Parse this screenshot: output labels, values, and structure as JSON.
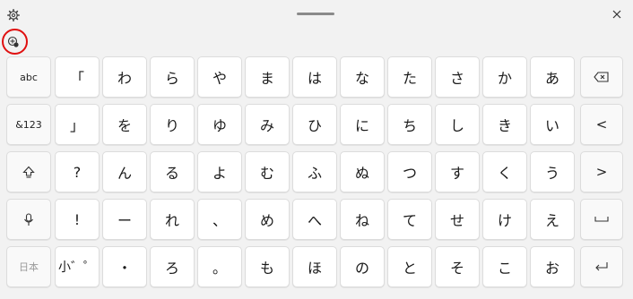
{
  "window": {
    "settings_icon": "gear-icon",
    "close_icon": "close-icon",
    "ime_icon": "ime-mode-icon"
  },
  "keys": {
    "row1": [
      "「",
      "わ",
      "ら",
      "や",
      "ま",
      "は",
      "な",
      "た",
      "さ",
      "か",
      "あ"
    ],
    "row2": [
      "」",
      "を",
      "り",
      "ゆ",
      "み",
      "ひ",
      "に",
      "ち",
      "し",
      "き",
      "い"
    ],
    "row3": [
      "?",
      "ん",
      "る",
      "よ",
      "む",
      "ふ",
      "ぬ",
      "つ",
      "す",
      "く",
      "う"
    ],
    "row4": [
      "!",
      "ー",
      "れ",
      "、",
      "め",
      "へ",
      "ね",
      "て",
      "せ",
      "け",
      "え"
    ],
    "row5": [
      "小゛゜",
      "・",
      "ろ",
      "。",
      "も",
      "ほ",
      "の",
      "と",
      "そ",
      "こ",
      "お"
    ]
  },
  "left_keys": {
    "abc": "abc",
    "symbols": "&123",
    "shift_icon": "shift-icon",
    "mic_icon": "microphone-icon",
    "language": "日本"
  },
  "right_keys": {
    "backspace_icon": "backspace-icon",
    "left_arrow": "<",
    "right_arrow": ">",
    "space_icon": "space-icon",
    "enter_icon": "enter-icon"
  }
}
